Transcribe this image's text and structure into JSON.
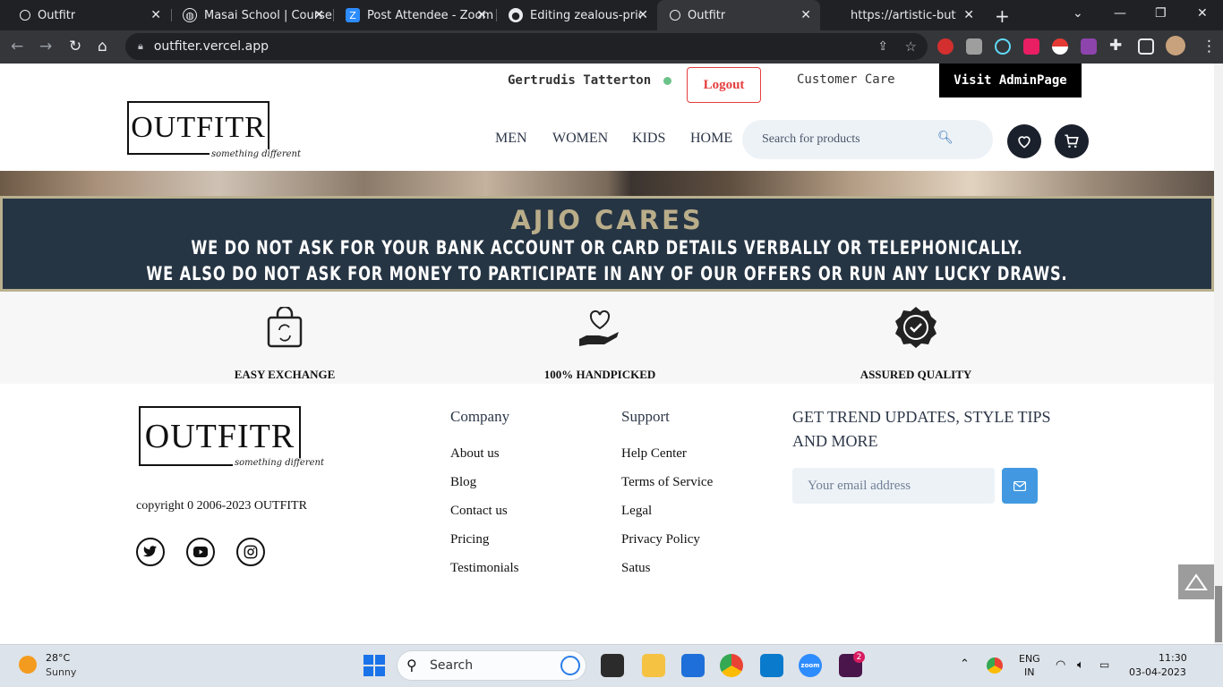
{
  "browser": {
    "tabs": [
      {
        "title": "Outfitr",
        "icon": "outfitr-favicon",
        "active": false
      },
      {
        "title": "Masai School | Course",
        "icon": "globe-icon",
        "active": false
      },
      {
        "title": "Post Attendee - Zoom",
        "icon": "zoom-icon",
        "active": false
      },
      {
        "title": "Editing zealous-price-",
        "icon": "github-icon",
        "active": false
      },
      {
        "title": "Outfitr",
        "icon": "outfitr-favicon",
        "active": true
      },
      {
        "title": "https://artistic-butterm",
        "icon": "none",
        "active": false
      }
    ],
    "new_tab": "+",
    "url": "outfiter.vercel.app"
  },
  "header": {
    "user_name": "Gertrudis Tatterton",
    "logout_label": "Logout",
    "customer_care": "Customer Care",
    "admin_label": "Visit AdminPage",
    "logo_text": "OUTFITR",
    "logo_tagline": "something different",
    "nav": [
      "MEN",
      "WOMEN",
      "KIDS",
      "HOME"
    ],
    "search_placeholder": "Search for products"
  },
  "banner": {
    "title": "AJIO CARES",
    "line1": "WE DO NOT ASK FOR YOUR BANK ACCOUNT OR CARD DETAILS VERBALLY OR TELEPHONICALLY.",
    "line2": "WE ALSO DO NOT ASK FOR MONEY TO PARTICIPATE IN ANY OF OUR OFFERS OR RUN ANY LUCKY DRAWS."
  },
  "features": [
    {
      "label": "EASY EXCHANGE",
      "icon": "exchange-bag-icon"
    },
    {
      "label": "100% HANDPICKED",
      "icon": "heart-hand-icon"
    },
    {
      "label": "ASSURED QUALITY",
      "icon": "quality-badge-icon"
    }
  ],
  "footer": {
    "logo_text": "OUTFITR",
    "logo_tagline": "something different",
    "copyright": "copyright 0 2006-2023 OUTFITR",
    "company": {
      "heading": "Company",
      "links": [
        "About us",
        "Blog",
        "Contact us",
        "Pricing",
        "Testimonials"
      ]
    },
    "support": {
      "heading": "Support",
      "links": [
        "Help Center",
        "Terms of Service",
        "Legal",
        "Privacy Policy",
        "Satus"
      ]
    },
    "newsletter": "GET TREND UPDATES, STYLE TIPS AND MORE",
    "email_placeholder": "Your email address"
  },
  "taskbar": {
    "temp": "28°C",
    "weather": "Sunny",
    "search": "Search",
    "lang1": "ENG",
    "lang2": "IN",
    "time": "11:30",
    "date": "03-04-2023",
    "notification_count": "2"
  },
  "colors": {
    "banner_bg": "#263544",
    "banner_gold": "#b9ad8a",
    "logout_red": "#e53e3e",
    "accent_blue": "#4299e1"
  }
}
